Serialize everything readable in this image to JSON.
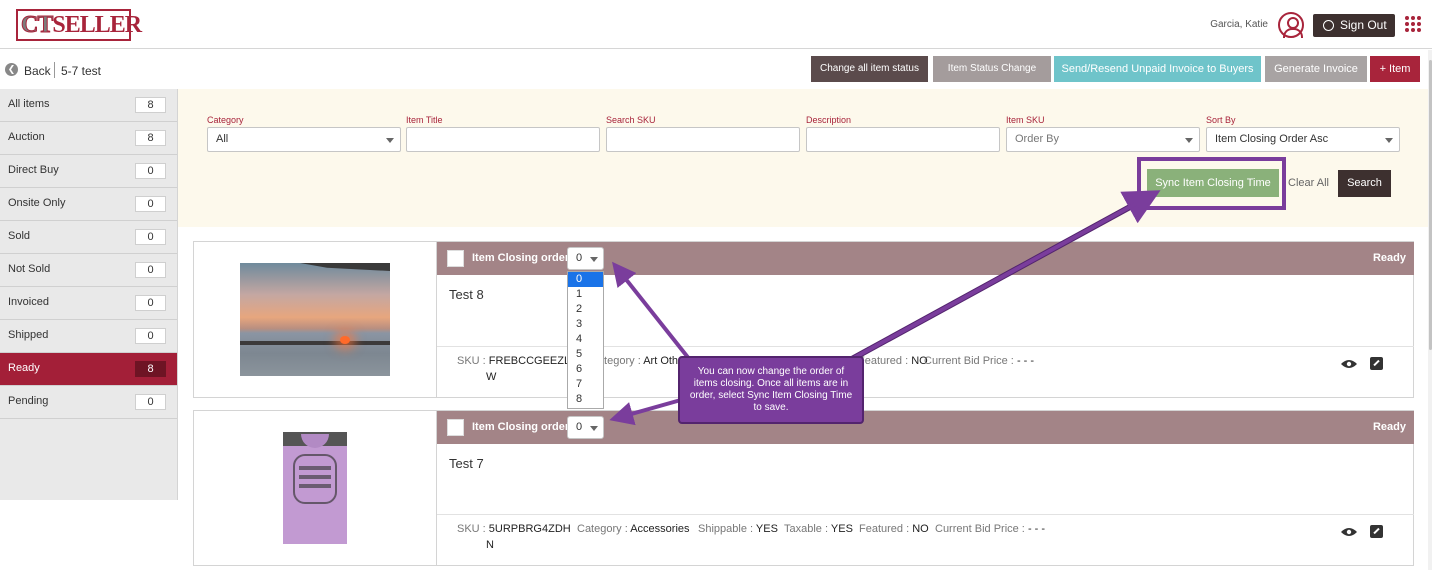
{
  "header": {
    "logo_ct": "CT",
    "logo_seller": "SELLER",
    "user_name": "Garcia, Katie",
    "signout_label": "Sign Out"
  },
  "subbar": {
    "back_label": "Back",
    "page_title": "5-7 test"
  },
  "actions": {
    "change_all": "Change all item status",
    "status_change": "Item Status Change",
    "resend": "Send/Resend Unpaid Invoice to Buyers",
    "generate": "Generate Invoice",
    "add_item": "+ Item"
  },
  "sidebar": {
    "items": [
      {
        "label": "All items",
        "count": "8"
      },
      {
        "label": "Auction",
        "count": "8"
      },
      {
        "label": "Direct Buy",
        "count": "0"
      },
      {
        "label": "Onsite Only",
        "count": "0"
      },
      {
        "label": "Sold",
        "count": "0"
      },
      {
        "label": "Not Sold",
        "count": "0"
      },
      {
        "label": "Invoiced",
        "count": "0"
      },
      {
        "label": "Shipped",
        "count": "0"
      },
      {
        "label": "Ready",
        "count": "8"
      },
      {
        "label": "Pending",
        "count": "0"
      }
    ],
    "active_index": 8
  },
  "filters": {
    "category_label": "Category",
    "category_value": "All",
    "title_label": "Item Title",
    "title_value": "",
    "sku_search_label": "Search SKU",
    "sku_search_value": "",
    "description_label": "Description",
    "description_value": "",
    "item_sku_label": "Item SKU",
    "item_sku_value": "Order By",
    "sort_label": "Sort By",
    "sort_value": "Item Closing Order Asc",
    "sync_label": "Sync Item Closing Time",
    "clear_label": "Clear All",
    "search_label": "Search"
  },
  "items": [
    {
      "order_label": "Item Closing order",
      "order_value": "0",
      "status": "Ready",
      "title": "Test 8",
      "sku_label": "SKU :",
      "sku_line1": "FREBCCGEEZL",
      "sku_line2": "W",
      "category_label": "Category :",
      "category": "Art Other",
      "featured_label": "Featured :",
      "featured": "NO",
      "bid_label": "Current Bid Price :",
      "bid": "- - -",
      "photo": "sunset-photo"
    },
    {
      "order_label": "Item Closing order",
      "order_value": "0",
      "status": "Ready",
      "title": "Test 7",
      "sku_label": "SKU :",
      "sku_line1": "5URPBRG4ZDH",
      "sku_line2": "N",
      "category_label": "Category :",
      "category": "Accessories",
      "shippable_label": "Shippable :",
      "shippable": "YES",
      "taxable_label": "Taxable :",
      "taxable": "YES",
      "featured_label": "Featured :",
      "featured": "NO",
      "bid_label": "Current Bid Price :",
      "bid": "- - -",
      "photo": "tshirt-photo"
    }
  ],
  "dropdown_options": [
    "0",
    "1",
    "2",
    "3",
    "4",
    "5",
    "6",
    "7",
    "8"
  ],
  "dropdown_selected": "0",
  "callout_text": "You can now change the order of items closing. Once all items are in order, select Sync Item Closing Time to save.",
  "colors": {
    "brand": "#a8243b",
    "dark": "#3d302f",
    "card_header": "#a38487",
    "sync_green": "#8ab17a",
    "annotation_purple": "#7a3d9c",
    "resend_teal": "#6fc4ca"
  }
}
